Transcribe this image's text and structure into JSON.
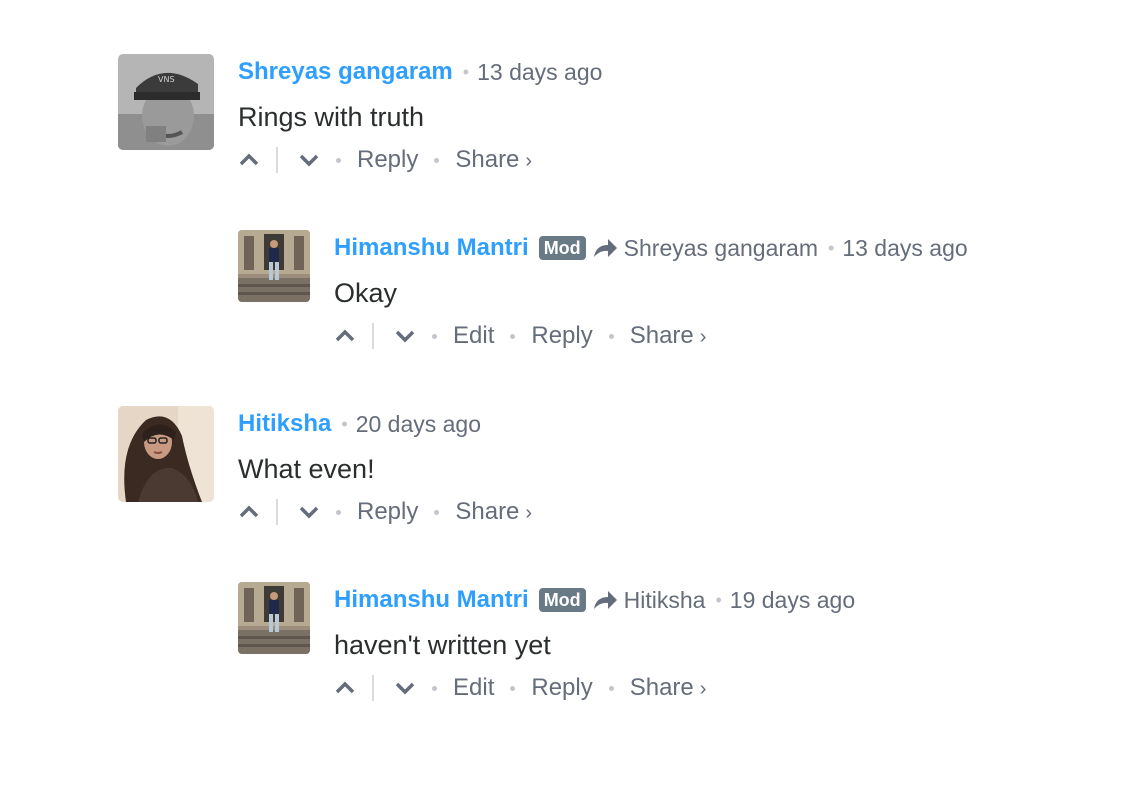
{
  "comments": [
    {
      "author": "Shreyas gangaram",
      "time": "13 days ago",
      "message": "Rings with truth",
      "actions": {
        "reply": "Reply",
        "share": "Share",
        "share_chevron": "›"
      },
      "reply": {
        "author": "Himanshu Mantri",
        "badge": "Mod",
        "in_reply_to": "Shreyas gangaram",
        "time": "13 days ago",
        "message": "Okay",
        "actions": {
          "edit": "Edit",
          "reply": "Reply",
          "share": "Share",
          "share_chevron": "›"
        }
      }
    },
    {
      "author": "Hitiksha",
      "time": "20 days ago",
      "message": "What even!",
      "actions": {
        "reply": "Reply",
        "share": "Share",
        "share_chevron": "›"
      },
      "reply": {
        "author": "Himanshu Mantri",
        "badge": "Mod",
        "in_reply_to": "Hitiksha",
        "time": "19 days ago",
        "message": "haven't written yet",
        "actions": {
          "edit": "Edit",
          "reply": "Reply",
          "share": "Share",
          "share_chevron": "›"
        }
      }
    }
  ],
  "icons": {
    "upvote": "chevron-up-icon",
    "downvote": "chevron-down-icon",
    "reply_to": "share-arrow-icon"
  },
  "colors": {
    "author": "#2e9fff",
    "meta": "#656c7a",
    "badge_bg": "#687a86",
    "text": "#2a2e2e"
  }
}
